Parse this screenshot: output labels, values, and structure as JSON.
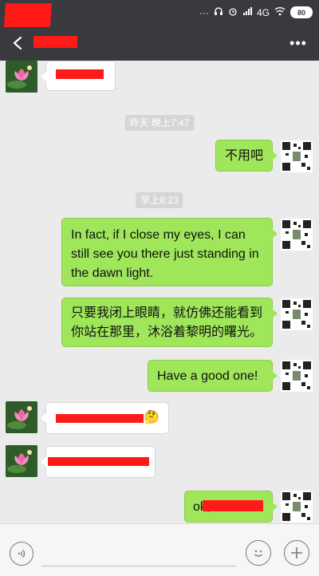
{
  "status": {
    "network": "4G",
    "battery": "80"
  },
  "titlebar": {
    "more": "•••"
  },
  "messages": {
    "m1_text": "",
    "time1": "昨天 晚上7:47",
    "m2_text": "不用吧",
    "time2": "早上8:23",
    "m3_text": "In fact, if I close my eyes, I can still see you there just standing in the dawn light.",
    "m4_text": "只要我闭上眼睛，就仿佛还能看到你站在那里，沐浴着黎明的曙光。",
    "m5_text": "Have a good one!",
    "m6_emoji": "🤔",
    "m8_visible": "ok,"
  },
  "colors": {
    "bubble_green": "#9fe65b",
    "redaction": "#ff1a1a",
    "titlebar": "#393a3e"
  }
}
